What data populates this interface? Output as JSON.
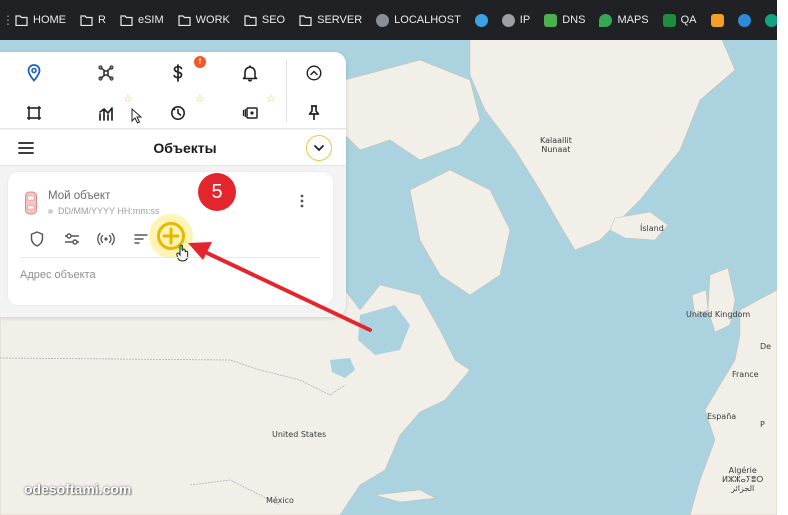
{
  "bookmarks": [
    {
      "label": "HOME",
      "icon": "folder-icon"
    },
    {
      "label": "R",
      "icon": "folder-icon"
    },
    {
      "label": "eSIM",
      "icon": "folder-icon"
    },
    {
      "label": "WORK",
      "icon": "folder-icon"
    },
    {
      "label": "SEO",
      "icon": "folder-icon"
    },
    {
      "label": "SERVER",
      "icon": "folder-icon"
    },
    {
      "label": "LOCALHOST",
      "icon": "localhost-icon"
    },
    {
      "label": "",
      "icon": "gear-site-icon"
    },
    {
      "label": "IP",
      "icon": "globe-icon"
    },
    {
      "label": "DNS",
      "icon": "dns-icon"
    },
    {
      "label": "MAPS",
      "icon": "maps-icon"
    },
    {
      "label": "QA",
      "icon": "qa-icon"
    },
    {
      "label": "",
      "icon": "mail-icon"
    },
    {
      "label": "",
      "icon": "edge-icon"
    },
    {
      "label": "",
      "icon": "openai-icon"
    },
    {
      "label": "",
      "icon": "ts-icon"
    }
  ],
  "toolbar": {
    "icons": [
      "location-pin-icon",
      "drone-icon",
      "dollar-icon",
      "bell-icon",
      "chevron-up-circle-icon",
      "crop-frame-icon",
      "stats-chart-icon",
      "history-clock-icon",
      "playlist-icon",
      "pin-icon"
    ],
    "dollar_badge": "!",
    "accent_color": "#f3c443"
  },
  "objects": {
    "title": "Объекты",
    "card": {
      "name": "Мой объект",
      "date": "DD/MM/YYYY HH:mm:ss",
      "address_label": "Адрес объекта",
      "actions": [
        "shield-icon",
        "sliders-icon",
        "signal-icon",
        "sort-icon",
        "add-circle-icon"
      ]
    }
  },
  "map": {
    "labels": {
      "kalaallit": "Kalaallit\nNunaat",
      "island": "Ísland",
      "uk": "United Kingdom",
      "usa": "United States",
      "france": "France",
      "espana": "España",
      "algerie": "Algérie\nⵍⵣⵣⴰⵢⴻⵔ\nالجزائر",
      "mexico": "México",
      "de": "De",
      "p": "P"
    }
  },
  "annotation": {
    "step_number": "5",
    "arrow_color": "#e3262e"
  },
  "watermark": "odesoftami.com"
}
